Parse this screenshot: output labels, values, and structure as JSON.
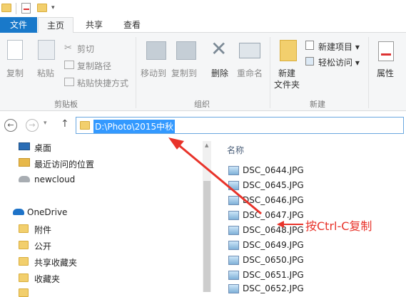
{
  "ribbon_tabs": {
    "file": "文件",
    "home": "主页",
    "share": "共享",
    "view": "查看"
  },
  "clipboard": {
    "copy": "复制",
    "paste": "粘贴",
    "cut": "剪切",
    "copy_path": "复制路径",
    "paste_shortcut": "粘贴快捷方式",
    "group": "剪贴板"
  },
  "organize": {
    "move_to": "移动到",
    "copy_to": "复制到",
    "delete": "删除",
    "rename": "重命名",
    "group": "组织"
  },
  "new_group": {
    "new_item": "新建项目 ▾",
    "easy_access": "轻松访问 ▾",
    "new_folder_l1": "新建",
    "new_folder_l2": "文件夹",
    "group": "新建"
  },
  "open_group": {
    "properties": "属性"
  },
  "address": {
    "path": "D:\\Photo\\2015中秋"
  },
  "nav": {
    "desktop": "桌面",
    "recent": "最近访问的位置",
    "newcloud": "newcloud",
    "onedrive": "OneDrive",
    "attachments": "附件",
    "public": "公开",
    "shared_favorites": "共享收藏夹",
    "favorites": "收藏夹"
  },
  "list": {
    "column_name": "名称",
    "files": [
      "DSC_0644.JPG",
      "DSC_0645.JPG",
      "DSC_0646.JPG",
      "DSC_0647.JPG",
      "DSC_0648.JPG",
      "DSC_0649.JPG",
      "DSC_0650.JPG",
      "DSC_0651.JPG",
      "DSC_0652.JPG"
    ]
  },
  "annotation": {
    "text": "按Ctrl-C复制",
    "color": "#e8332a"
  }
}
